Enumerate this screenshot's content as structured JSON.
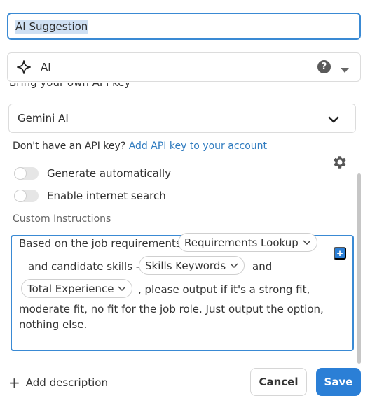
{
  "name_input": {
    "value": "AI Suggestion"
  },
  "field_type": {
    "label": "AI",
    "icon": "sparkle-icon",
    "help": "?"
  },
  "api_key": {
    "heading": "Bring your own API key",
    "provider": "Gemini AI",
    "no_key_text": "Don't have an API key?",
    "add_key_link": "Add API key to your account"
  },
  "toggles": {
    "generate_automatically": {
      "label": "Generate automatically",
      "on": false
    },
    "enable_internet_search": {
      "label": "Enable internet search",
      "on": false
    }
  },
  "custom_instructions": {
    "label": "Custom Instructions",
    "text_1": "Based on the job requirements",
    "chip_1": "Requirements Lookup",
    "text_2": "and candidate skills -",
    "chip_2": "Skills Keywords",
    "text_3": "and",
    "chip_3": "Total Experience",
    "text_4": ", please output if it's a strong fit,",
    "text_5": "moderate fit, no fit for the job role. Just output the option,",
    "text_6": "nothing else.",
    "insert_button": "+"
  },
  "footer": {
    "add_description": "Add description",
    "cancel": "Cancel",
    "save": "Save"
  },
  "colors": {
    "accent": "#2b7fd6",
    "focus_border": "#3a8ad4",
    "link": "#2f7bbf"
  }
}
